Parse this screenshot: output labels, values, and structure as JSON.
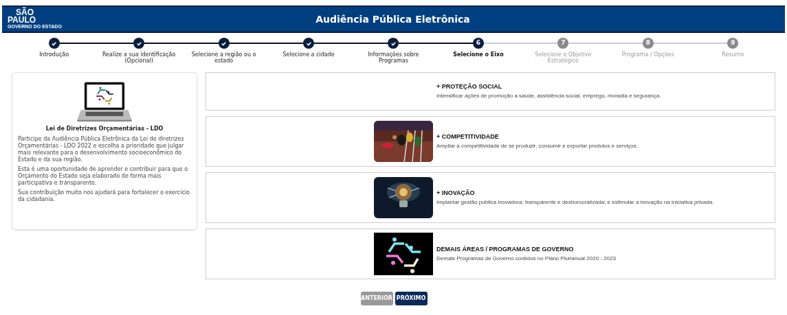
{
  "header": {
    "logo": {
      "line1": "SÃO",
      "line2": "PAULO",
      "line3": "GOVERNO DO ESTADO"
    },
    "title": "Audiência Pública Eletrônica"
  },
  "steps": [
    {
      "label": "Introdução",
      "completed": true,
      "selected": false
    },
    {
      "label": "Realize a sua identificação (Opcional)",
      "completed": true,
      "selected": false
    },
    {
      "label": "Selecione a região ou o estado",
      "completed": true,
      "selected": false
    },
    {
      "label": "Selecione a cidade",
      "completed": true,
      "selected": false
    },
    {
      "label": "Informações sobre Programas",
      "completed": true,
      "selected": false
    },
    {
      "label": "Selecione o Eixo",
      "completed": false,
      "selected": true,
      "number": "6"
    },
    {
      "label": "Selecione o Objetivo Estratégico",
      "completed": false,
      "selected": false,
      "number": "7"
    },
    {
      "label": "Programa / Opções",
      "completed": false,
      "selected": false,
      "number": "8"
    },
    {
      "label": "Resumo",
      "completed": false,
      "selected": false,
      "number": "9"
    }
  ],
  "info_card": {
    "title": "Lei de Diretrizes Orçamentárias - LDO",
    "paragraphs": [
      "Participe da Audiência Pública Eletrônica da Lei de diretrizes Orçamentárias - LDO 2022 e escolha a prioridade que julgar mais relevante para o desenvolvimento socioeconômico do Estado e da sua região.",
      "Esta é uma oportunidade de aprender e contribuir para que o Orçamento do Estado seja elaborado de forma mais participativa e transparente.",
      "Sua contribuição muito nos ajudará para fortalecer o exercício da cidadania."
    ]
  },
  "axes": [
    {
      "title": "+ PROTEÇÃO SOCIAL",
      "description": "Intensificar ações de promoção a saúde, assistência social, emprego, moradia e segurança."
    },
    {
      "title": "+ COMPETITIVIDADE",
      "description": "Ampliar a competitividade de se produzir, consumir e exportar produtos e serviços.",
      "kind": "picture"
    },
    {
      "title": "+ INOVAÇÃO",
      "description": "Implantar gestão pública inovadora, transparente e desburocratizada; e estimular a inovação na iniciativa privada.",
      "kind": "picture"
    },
    {
      "title": "DEMAIS ÁREAS / PROGRAMAS DE GOVERNO",
      "description": "Demais Programas de Governo contidos no Plano Plurianual 2020 - 2023",
      "kind": "logo"
    }
  ],
  "buttons": [
    {
      "label": "ANTERIOR",
      "kind": "secondary"
    },
    {
      "label": "PRÓXIMO",
      "kind": "primary"
    }
  ]
}
